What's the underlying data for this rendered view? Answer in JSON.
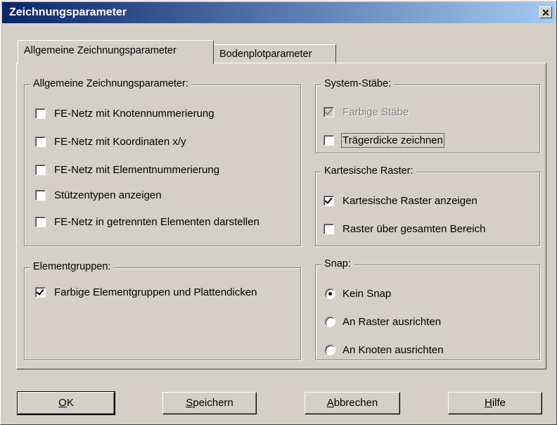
{
  "window": {
    "title": "Zeichnungsparameter",
    "close_glyph": "✕"
  },
  "tabs": [
    {
      "label": "Allgemeine Zeichnungsparameter",
      "active": true
    },
    {
      "label": "Bodenplotparameter",
      "active": false
    }
  ],
  "groups": {
    "general": {
      "title": "Allgemeine Zeichnungsparameter:",
      "items": [
        {
          "label": "FE-Netz mit Knotennummerierung",
          "checked": false
        },
        {
          "label": "FE-Netz mit Koordinaten x/y",
          "checked": false
        },
        {
          "label": "FE-Netz mit Elementnummerierung",
          "checked": false
        },
        {
          "label": "Stützentypen anzeigen",
          "checked": false
        },
        {
          "label": "FE-Netz in getrennten Elementen darstellen",
          "checked": false
        }
      ]
    },
    "element_groups": {
      "title": "Elementgruppen:",
      "items": [
        {
          "label": "Farbige Elementgruppen und Plattendicken",
          "checked": true
        }
      ]
    },
    "system_bars": {
      "title": "System-Stäbe:",
      "items": [
        {
          "label": "Farbige Stäbe",
          "checked": true,
          "disabled": true
        },
        {
          "label": "Trägerdicke zeichnen",
          "checked": false,
          "focused": true
        }
      ]
    },
    "cartesian": {
      "title": "Kartesische Raster:",
      "items": [
        {
          "label": "Kartesische Raster anzeigen",
          "checked": true
        },
        {
          "label": "Raster über gesamten Bereich",
          "checked": false
        }
      ]
    },
    "snap": {
      "title": "Snap:",
      "options": [
        {
          "label": "Kein Snap",
          "selected": true
        },
        {
          "label": "An Raster ausrichten",
          "selected": false
        },
        {
          "label": "An Knoten ausrichten",
          "selected": false
        }
      ]
    }
  },
  "buttons": {
    "ok": {
      "accel": "O",
      "rest": "K"
    },
    "save": {
      "accel": "S",
      "rest": "peichern"
    },
    "cancel": {
      "accel": "A",
      "rest": "bbrechen"
    },
    "help": {
      "accel": "H",
      "rest": "ilfe"
    }
  }
}
